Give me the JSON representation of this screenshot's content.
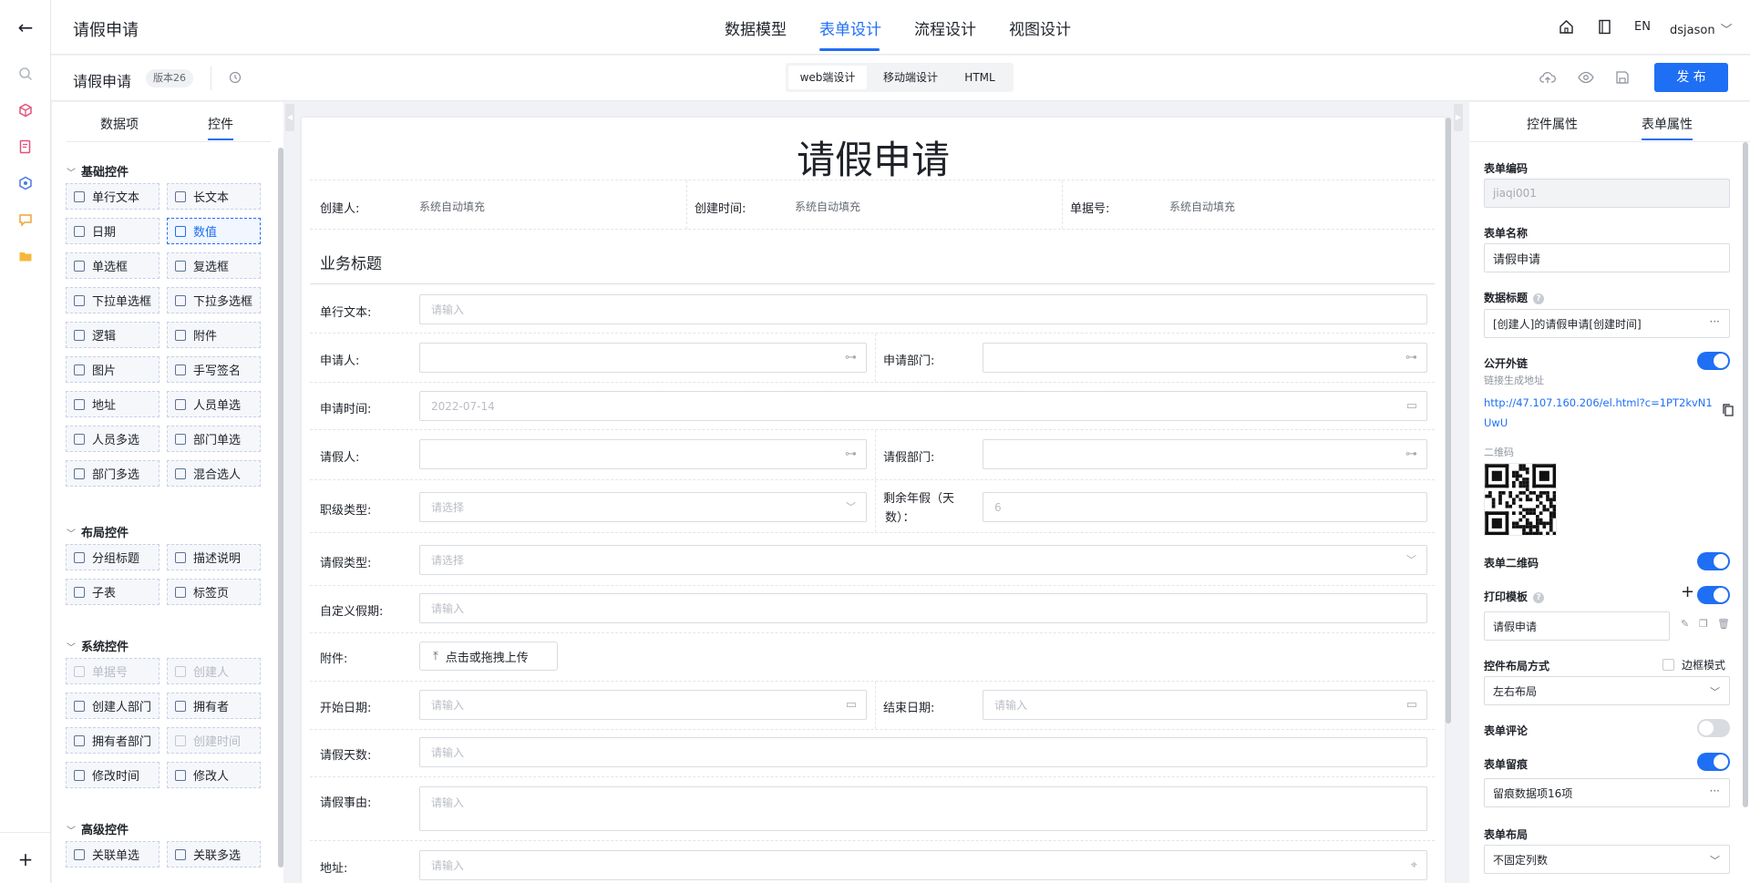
{
  "topbar": {
    "app_title": "请假申请",
    "tabs": [
      "数据模型",
      "表单设计",
      "流程设计",
      "视图设计"
    ],
    "lang": "EN",
    "user": "dsjason"
  },
  "toolbar": {
    "form_name": "请假申请",
    "version": "版本26",
    "modes": [
      "web端设计",
      "移动端设计",
      "HTML"
    ],
    "publish": "发 布"
  },
  "left": {
    "tabs": [
      "数据项",
      "控件"
    ],
    "sections": [
      {
        "title": "基础控件",
        "items": [
          "单行文本",
          "长文本",
          "日期",
          "数值",
          "单选框",
          "复选框",
          "下拉单选框",
          "下拉多选框",
          "逻辑",
          "附件",
          "图片",
          "手写签名",
          "地址",
          "人员单选",
          "人员多选",
          "部门单选",
          "部门多选",
          "混合选人"
        ]
      },
      {
        "title": "布局控件",
        "items": [
          "分组标题",
          "描述说明",
          "子表",
          "标签页"
        ]
      },
      {
        "title": "系统控件",
        "items": [
          "单据号",
          "创建人",
          "创建人部门",
          "拥有者",
          "拥有者部门",
          "创建时间",
          "修改时间",
          "修改人"
        ]
      },
      {
        "title": "高级控件",
        "items": [
          "关联单选",
          "关联多选"
        ]
      }
    ]
  },
  "form": {
    "title": "请假申请",
    "creator_label": "创建人:",
    "creator_value": "系统自动填充",
    "created_time_label": "创建时间:",
    "created_time_value": "系统自动填充",
    "doc_no_label": "单据号:",
    "doc_no_value": "系统自动填充",
    "section_title": "业务标题",
    "fields": {
      "single_text": {
        "label": "单行文本:",
        "placeholder": "请输入"
      },
      "applicant": {
        "label": "申请人:"
      },
      "applicant_dept": {
        "label": "申请部门:"
      },
      "apply_time": {
        "label": "申请时间:",
        "value": "2022-07-14"
      },
      "leave_person": {
        "label": "请假人:"
      },
      "leave_dept": {
        "label": "请假部门:"
      },
      "rank_type": {
        "label": "职级类型:",
        "placeholder": "请选择"
      },
      "remaining": {
        "label_line1": "剩余年假（天",
        "label_line2": "数）：",
        "value": "6"
      },
      "leave_type": {
        "label": "请假类型:",
        "placeholder": "请选择"
      },
      "custom_period": {
        "label": "自定义假期:",
        "placeholder": "请输入"
      },
      "attachment": {
        "label": "附件:",
        "button": "点击或拖拽上传"
      },
      "start_date": {
        "label": "开始日期:",
        "placeholder": "请输入"
      },
      "end_date": {
        "label": "结束日期:",
        "placeholder": "请输入"
      },
      "days": {
        "label": "请假天数:",
        "placeholder": "请输入"
      },
      "reason": {
        "label": "请假事由:",
        "placeholder": "请输入"
      },
      "address": {
        "label": "地址:",
        "placeholder": "请输入"
      }
    }
  },
  "right": {
    "tabs": [
      "控件属性",
      "表单属性"
    ],
    "form_code_label": "表单编码",
    "form_code": "jiaqi001",
    "form_name_label": "表单名称",
    "form_name": "请假申请",
    "data_title_label": "数据标题",
    "data_title": "[创建人]的请假申请[创建时间]",
    "public_link_label": "公开外链",
    "public_link_hint": "链接生成地址",
    "public_link_line1": "http://47.107.160.206/el.html?c=1PT2kvN1",
    "public_link_line2": "UwU",
    "qr_label": "二维码",
    "form_qr_label": "表单二维码",
    "print_label": "打印模板",
    "print_value": "请假申请",
    "layout_label": "控件布局方式",
    "border_mode": "边框模式",
    "layout_value": "左右布局",
    "comment_label": "表单评论",
    "trace_label": "表单留痕",
    "trace_value": "留痕数据项16项",
    "form_layout_label": "表单布局",
    "form_layout_value": "不固定列数"
  },
  "icons": {
    "back": "arrow-left-icon",
    "home": "home-icon",
    "doc": "book-icon",
    "history": "clock-icon",
    "upload_cloud": "cloud-upload-icon",
    "preview": "eye-icon",
    "save": "save-icon",
    "dots": "more-icon"
  }
}
